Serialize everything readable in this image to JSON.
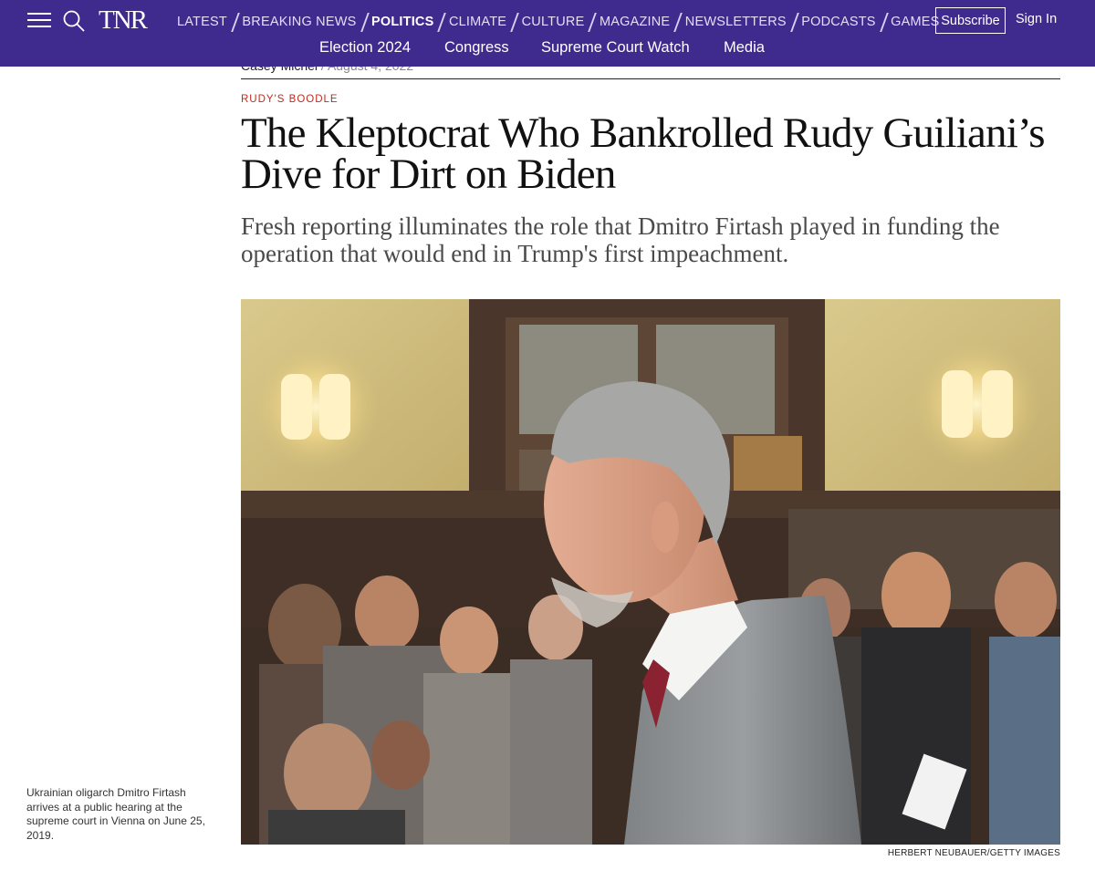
{
  "nav": {
    "logo": "TNR",
    "sections": [
      {
        "label": "LATEST",
        "active": false
      },
      {
        "label": "BREAKING NEWS",
        "active": false
      },
      {
        "label": "POLITICS",
        "active": true
      },
      {
        "label": "CLIMATE",
        "active": false
      },
      {
        "label": "CULTURE",
        "active": false
      },
      {
        "label": "MAGAZINE",
        "active": false
      },
      {
        "label": "NEWSLETTERS",
        "active": false
      },
      {
        "label": "PODCASTS",
        "active": false
      },
      {
        "label": "GAMES",
        "active": false
      }
    ],
    "subscribe_label": "Subscribe",
    "signin_label": "Sign In",
    "subnav": [
      "Election 2024",
      "Congress",
      "Supreme Court Watch",
      "Media"
    ],
    "colors": {
      "bar": "#3f2a8e",
      "text": "#ffffff"
    }
  },
  "article": {
    "author": "Casey Michel",
    "date": "August 4, 2022",
    "kicker": "RUDY'S BOODLE",
    "headline": "The Kleptocrat Who Bankrolled Rudy Guiliani’s Dive for Dirt on Biden",
    "dek": "Fresh reporting illuminates the role that Dmitro Firtash played in funding the operation that would end in Trump's first impeachment.",
    "image_caption": "Ukrainian oligarch Dmitro Firtash arrives at a public hearing at the supreme court in Vienna on June 25, 2019.",
    "image_credit": "HERBERT NEUBAUER/GETTY IMAGES",
    "colors": {
      "kicker": "#c4291f",
      "headline": "#111111",
      "dek": "#4a4a4a"
    }
  }
}
